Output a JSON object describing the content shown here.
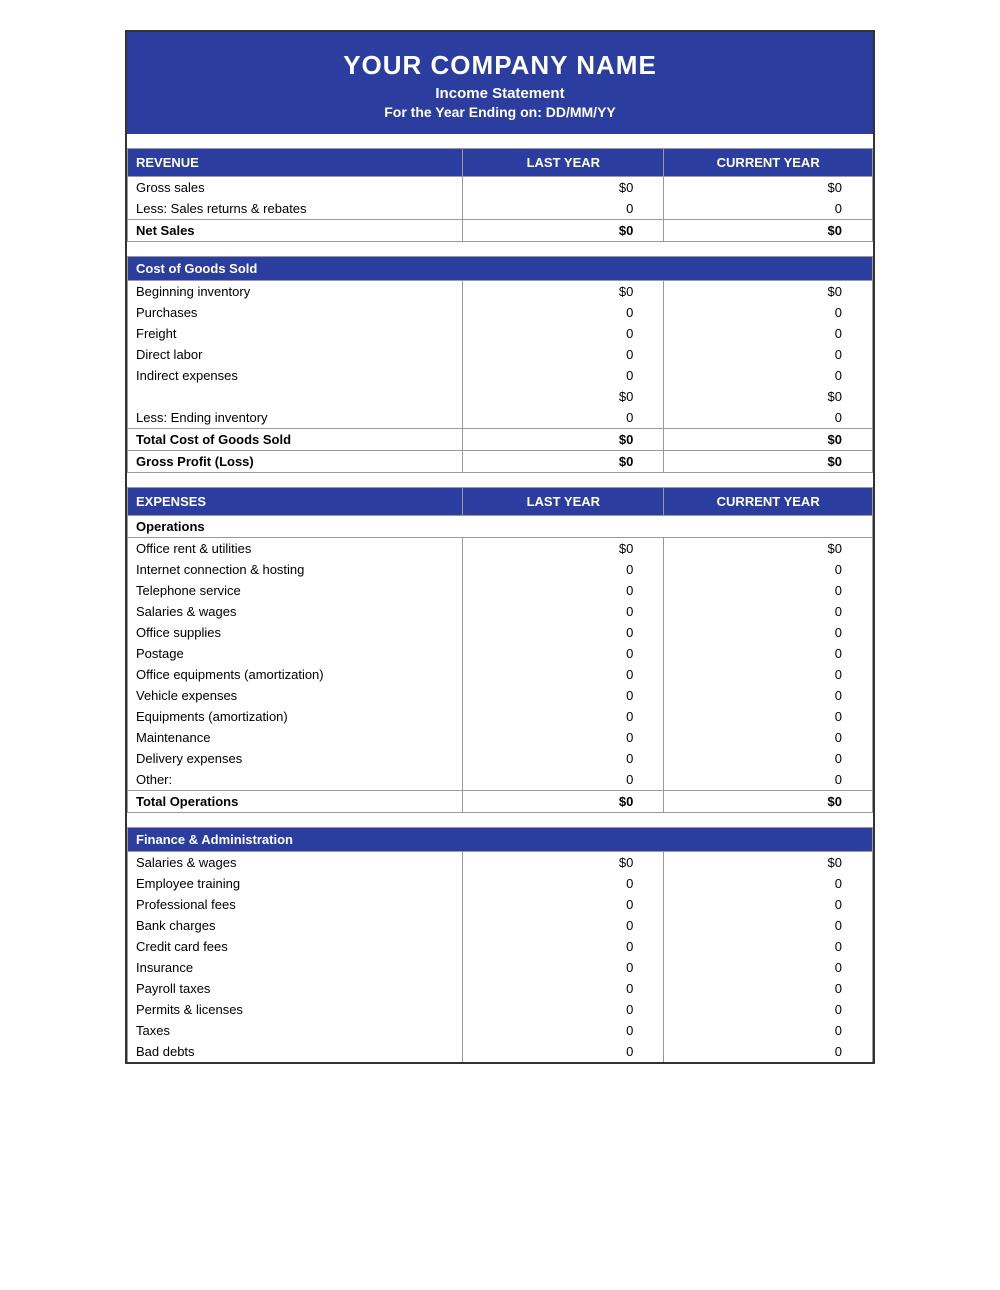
{
  "header": {
    "company_name": "YOUR COMPANY NAME",
    "doc_title": "Income Statement",
    "doc_subtitle": "For the Year Ending on: DD/MM/YY"
  },
  "revenue_section": {
    "label": "REVENUE",
    "last_year_label": "LAST YEAR",
    "current_year_label": "CURRENT YEAR",
    "rows": [
      {
        "label": "Gross sales",
        "last_year": "$0",
        "current_year": "$0"
      },
      {
        "label": "Less: Sales returns & rebates",
        "last_year": "0",
        "current_year": "0"
      }
    ],
    "total_label": "Net Sales",
    "total_last_year": "$0",
    "total_current_year": "$0"
  },
  "cogs_section": {
    "label": "Cost of Goods Sold",
    "rows": [
      {
        "label": "Beginning inventory",
        "last_year": "$0",
        "current_year": "$0"
      },
      {
        "label": "Purchases",
        "last_year": "0",
        "current_year": "0"
      },
      {
        "label": "Freight",
        "last_year": "0",
        "current_year": "0"
      },
      {
        "label": "Direct labor",
        "last_year": "0",
        "current_year": "0"
      },
      {
        "label": "Indirect expenses",
        "last_year": "0",
        "current_year": "0"
      }
    ],
    "subtotal_last_year": "$0",
    "subtotal_current_year": "$0",
    "ending_inventory_label": "Less: Ending inventory",
    "ending_inventory_last_year": "0",
    "ending_inventory_current_year": "0",
    "total_label": "Total Cost of Goods Sold",
    "total_last_year": "$0",
    "total_current_year": "$0",
    "gross_profit_label": "Gross Profit (Loss)",
    "gross_profit_last_year": "$0",
    "gross_profit_current_year": "$0"
  },
  "expenses_section": {
    "label": "EXPENSES",
    "last_year_label": "LAST YEAR",
    "current_year_label": "CURRENT YEAR",
    "operations_label": "Operations",
    "operations_rows": [
      {
        "label": "Office rent & utilities",
        "last_year": "$0",
        "current_year": "$0"
      },
      {
        "label": "Internet connection & hosting",
        "last_year": "0",
        "current_year": "0"
      },
      {
        "label": "Telephone service",
        "last_year": "0",
        "current_year": "0"
      },
      {
        "label": "Salaries & wages",
        "last_year": "0",
        "current_year": "0"
      },
      {
        "label": "Office supplies",
        "last_year": "0",
        "current_year": "0"
      },
      {
        "label": "Postage",
        "last_year": "0",
        "current_year": "0"
      },
      {
        "label": "Office equipments (amortization)",
        "last_year": "0",
        "current_year": "0"
      },
      {
        "label": "Vehicle expenses",
        "last_year": "0",
        "current_year": "0"
      },
      {
        "label": "Equipments (amortization)",
        "last_year": "0",
        "current_year": "0"
      },
      {
        "label": "Maintenance",
        "last_year": "0",
        "current_year": "0"
      },
      {
        "label": "Delivery expenses",
        "last_year": "0",
        "current_year": "0"
      },
      {
        "label": "Other:",
        "last_year": "0",
        "current_year": "0"
      }
    ],
    "total_operations_label": "Total Operations",
    "total_operations_last_year": "$0",
    "total_operations_current_year": "$0",
    "finance_label": "Finance & Administration",
    "finance_rows": [
      {
        "label": "Salaries & wages",
        "last_year": "$0",
        "current_year": "$0"
      },
      {
        "label": "Employee training",
        "last_year": "0",
        "current_year": "0"
      },
      {
        "label": "Professional fees",
        "last_year": "0",
        "current_year": "0"
      },
      {
        "label": "Bank charges",
        "last_year": "0",
        "current_year": "0"
      },
      {
        "label": "Credit card fees",
        "last_year": "0",
        "current_year": "0"
      },
      {
        "label": "Insurance",
        "last_year": "0",
        "current_year": "0"
      },
      {
        "label": "Payroll taxes",
        "last_year": "0",
        "current_year": "0"
      },
      {
        "label": "Permits & licenses",
        "last_year": "0",
        "current_year": "0"
      },
      {
        "label": "Taxes",
        "last_year": "0",
        "current_year": "0"
      },
      {
        "label": "Bad debts",
        "last_year": "0",
        "current_year": "0"
      }
    ]
  }
}
